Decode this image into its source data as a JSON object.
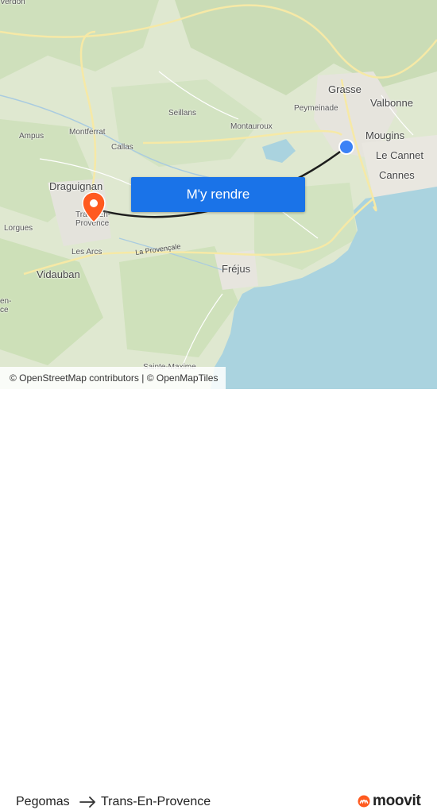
{
  "map": {
    "places": {
      "verdon": "Verdon",
      "grasse": "Grasse",
      "valbonne": "Valbonne",
      "peymeinade": "Peymeinade",
      "mougins": "Mougins",
      "seillans": "Seillans",
      "montauroux": "Montauroux",
      "le_cannet": "Le Cannet",
      "cannes": "Cannes",
      "montferrat": "Montferrat",
      "ampus": "Ampus",
      "callas": "Callas",
      "draguignan": "Draguignan",
      "trans_en_provence": "Trans-En-Provence",
      "lorgues": "Lorgues",
      "les_arcs": "Les Arcs",
      "vidauban": "Vidauban",
      "frejus": "Fréjus",
      "sainte_maxime": "Sainte-Maxime",
      "la_provencale": "La Provençale",
      "en_ce": "en-\nce"
    },
    "cta_label": "M'y rendre",
    "attribution": {
      "osm": "© OpenStreetMap contributors",
      "separator": " | ",
      "omt": "© OpenMapTiles"
    },
    "colors": {
      "route": "#1d1d1d",
      "origin_marker": "#3b82f6",
      "destination_marker": "#ff5a1f",
      "water": "#aad3df",
      "button": "#1a73e8"
    }
  },
  "footer": {
    "origin": "Pegomas",
    "destination": "Trans-En-Provence",
    "arrow_icon": "arrow-right-icon",
    "brand": "moovit",
    "brand_color": "#ff5a1f"
  }
}
